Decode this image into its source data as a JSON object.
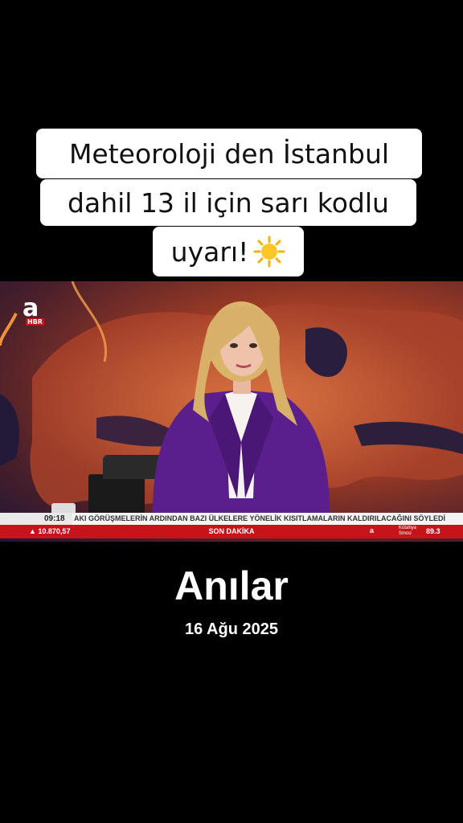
{
  "caption": {
    "line1": "Meteoroloji den İstanbul",
    "line2": "dahil  13 il için sarı kodlu",
    "line3": "uyarı!",
    "emoji_icon": "sun-emoji-icon"
  },
  "video": {
    "logo_letter": "a",
    "logo_badge": "HBR",
    "ticker_time": "09:18",
    "ticker_text": "AKI GÖRÜŞMELERİN ARDINDAN BAZI ÜLKELERE YÖNELİK KISITLAMALARIN KALDIRILACAĞINI SÖYLEDİ",
    "bourse_value": "▲ 10.870,57",
    "breaking_label": "SON DAKİKA",
    "weather_brand": "a",
    "weather_city": "Kütahya\nSmoo",
    "weather_value": "89.3"
  },
  "title": "Anılar",
  "date": "16 Ağu 2025",
  "colors": {
    "background": "#000000",
    "caption_bg": "#ffffff",
    "ticker_red": "#c7141b",
    "suit_purple": "#5a1f8c"
  }
}
